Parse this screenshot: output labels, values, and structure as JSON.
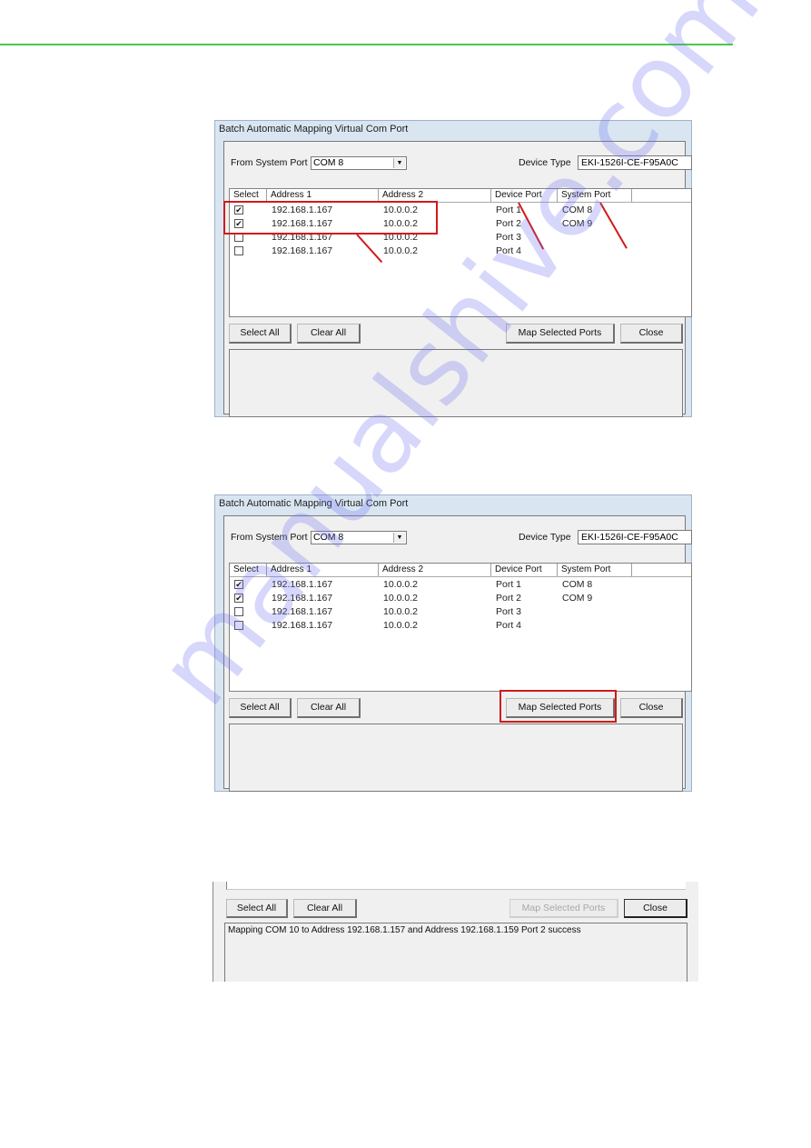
{
  "header": {
    "rule_color": "#4cc94c"
  },
  "dialog": {
    "title": "Batch Automatic Mapping Virtual Com Port",
    "from_system_port_label": "From System Port",
    "from_system_port_value": "COM 8",
    "device_type_label": "Device Type",
    "device_type_value": "EKI-1526I-CE-F95A0C",
    "columns": [
      "Select",
      "Address 1",
      "Address 2",
      "Device Port",
      "System Port"
    ],
    "rows": [
      {
        "checked": true,
        "address1": "192.168.1.167",
        "address2": "10.0.0.2",
        "device_port": "Port 1",
        "system_port": "COM 8"
      },
      {
        "checked": true,
        "address1": "192.168.1.167",
        "address2": "10.0.0.2",
        "device_port": "Port 2",
        "system_port": "COM 9"
      },
      {
        "checked": false,
        "address1": "192.168.1.167",
        "address2": "10.0.0.2",
        "device_port": "Port 3",
        "system_port": ""
      },
      {
        "checked": false,
        "address1": "192.168.1.167",
        "address2": "10.0.0.2",
        "device_port": "Port 4",
        "system_port": ""
      }
    ],
    "buttons": {
      "select_all": "Select All",
      "clear_all": "Clear All",
      "map_selected": "Map Selected Ports",
      "close": "Close"
    },
    "checkmark": "✔",
    "dropdown_arrow": "▼"
  },
  "result": {
    "log_message": "Mapping COM 10 to Address 192.168.1.157 and Address 192.168.1.159 Port 2 success"
  },
  "watermark": "manualshive.com",
  "annotation_color": "#d11a1a"
}
